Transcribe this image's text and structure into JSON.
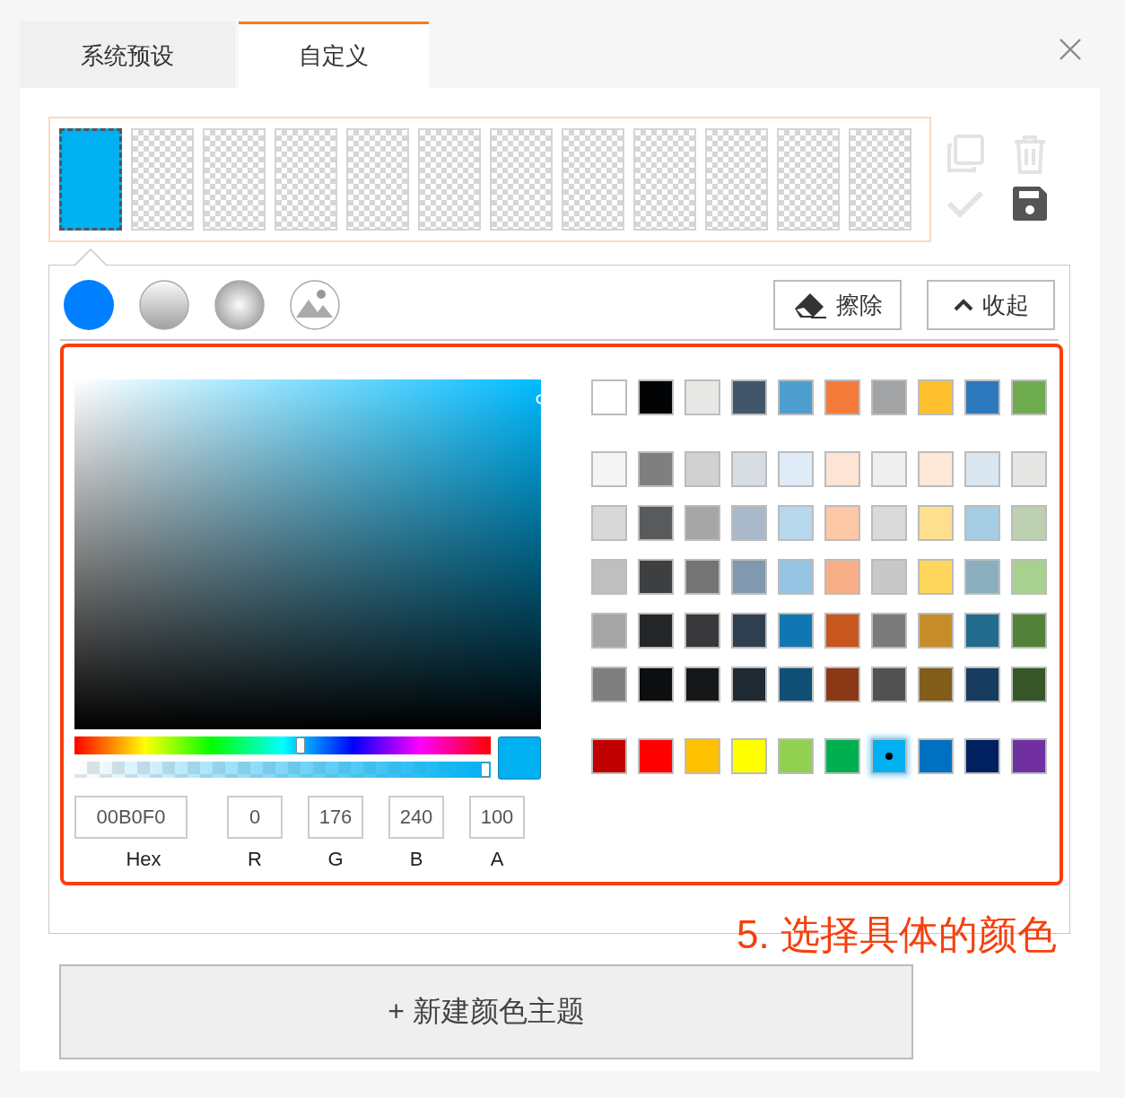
{
  "tabs": [
    {
      "label": "系统预设",
      "selected": false
    },
    {
      "label": "自定义",
      "selected": true
    }
  ],
  "theme_slots": [
    {
      "color": "#00b0f0",
      "selected": true
    },
    {
      "selected": false
    },
    {
      "selected": false
    },
    {
      "selected": false
    },
    {
      "selected": false
    },
    {
      "selected": false
    },
    {
      "selected": false
    },
    {
      "selected": false
    },
    {
      "selected": false
    },
    {
      "selected": false
    },
    {
      "selected": false
    },
    {
      "selected": false
    }
  ],
  "actions": [
    {
      "kind": "copy",
      "disabled": true
    },
    {
      "kind": "delete",
      "disabled": true
    },
    {
      "kind": "confirm",
      "disabled": true
    },
    {
      "kind": "save",
      "disabled": false
    }
  ],
  "buttons": [
    {
      "kind": "erase",
      "label": "擦除"
    },
    {
      "kind": "collapse",
      "label": "收起"
    }
  ],
  "picker": {
    "hue": {
      "level": 0.544
    },
    "alpha": {
      "level": 1
    },
    "fields": [
      {
        "value": "00B0F0",
        "label": "Hex"
      },
      {
        "value": "0",
        "label": "R"
      },
      {
        "value": "176",
        "label": "G"
      },
      {
        "value": "240",
        "label": "B"
      },
      {
        "value": "100",
        "label": "A"
      }
    ]
  },
  "swatch_groups": [
    [
      [
        {
          "color": "#ffffff",
          "selected": false
        },
        {
          "color": "#020305",
          "selected": false
        },
        {
          "color": "#e7e8e6",
          "selected": false
        },
        {
          "color": "#41566a",
          "selected": false
        },
        {
          "color": "#4e9fcf",
          "selected": false
        },
        {
          "color": "#f47b3a",
          "selected": false
        },
        {
          "color": "#a2a3a5",
          "selected": false
        },
        {
          "color": "#fdbf2d",
          "selected": false
        },
        {
          "color": "#2e78bd",
          "selected": false
        },
        {
          "color": "#6fac4f",
          "selected": false
        }
      ]
    ],
    [
      [
        {
          "color": "#f5f5f5",
          "selected": false
        },
        {
          "color": "#7f7f7f",
          "selected": false
        },
        {
          "color": "#d1d1d1",
          "selected": false
        },
        {
          "color": "#d7dde2",
          "selected": false
        },
        {
          "color": "#dfebf7",
          "selected": false
        },
        {
          "color": "#fde5d5",
          "selected": false
        },
        {
          "color": "#efefef",
          "selected": false
        },
        {
          "color": "#fee8d7",
          "selected": false
        },
        {
          "color": "#dae6f0",
          "selected": false
        },
        {
          "color": "#e6e7e5",
          "selected": false
        }
      ],
      [
        {
          "color": "#d8d8d8",
          "selected": false
        },
        {
          "color": "#595a5c",
          "selected": false
        },
        {
          "color": "#a6a6a6",
          "selected": false
        },
        {
          "color": "#a9b9c9",
          "selected": false
        },
        {
          "color": "#b7d8ec",
          "selected": false
        },
        {
          "color": "#fcc8a5",
          "selected": false
        },
        {
          "color": "#dadada",
          "selected": false
        },
        {
          "color": "#fedf8e",
          "selected": false
        },
        {
          "color": "#a5cde3",
          "selected": false
        },
        {
          "color": "#bdd0b2",
          "selected": false
        }
      ],
      [
        {
          "color": "#bfbfbf",
          "selected": false
        },
        {
          "color": "#3e3f41",
          "selected": false
        },
        {
          "color": "#747474",
          "selected": false
        },
        {
          "color": "#8199b0",
          "selected": false
        },
        {
          "color": "#96c4e3",
          "selected": false
        },
        {
          "color": "#f8af88",
          "selected": false
        },
        {
          "color": "#c8c8c8",
          "selected": false
        },
        {
          "color": "#fed65c",
          "selected": false
        },
        {
          "color": "#8aaebe",
          "selected": false
        },
        {
          "color": "#a8d08f",
          "selected": false
        }
      ],
      [
        {
          "color": "#a5a5a5",
          "selected": false
        },
        {
          "color": "#252628",
          "selected": false
        },
        {
          "color": "#38383a",
          "selected": false
        },
        {
          "color": "#2e4050",
          "selected": false
        },
        {
          "color": "#1077b3",
          "selected": false
        },
        {
          "color": "#c8561f",
          "selected": false
        },
        {
          "color": "#7b7b7b",
          "selected": false
        },
        {
          "color": "#c68d2a",
          "selected": false
        },
        {
          "color": "#226a8e",
          "selected": false
        },
        {
          "color": "#528139",
          "selected": false
        }
      ],
      [
        {
          "color": "#7f7f7f",
          "selected": false
        },
        {
          "color": "#0c0e10",
          "selected": false
        },
        {
          "color": "#161718",
          "selected": false
        },
        {
          "color": "#1f2a33",
          "selected": false
        },
        {
          "color": "#0f4f75",
          "selected": false
        },
        {
          "color": "#8b3816",
          "selected": false
        },
        {
          "color": "#525252",
          "selected": false
        },
        {
          "color": "#815d1a",
          "selected": false
        },
        {
          "color": "#173c5e",
          "selected": false
        },
        {
          "color": "#365628",
          "selected": false
        }
      ]
    ],
    [
      [
        {
          "color": "#c00000",
          "selected": false
        },
        {
          "color": "#ff0000",
          "selected": false
        },
        {
          "color": "#ffc000",
          "selected": false
        },
        {
          "color": "#ffff00",
          "selected": false
        },
        {
          "color": "#92d050",
          "selected": false
        },
        {
          "color": "#00b050",
          "selected": false
        },
        {
          "color": "#00b0f0",
          "selected": true
        },
        {
          "color": "#0070c0",
          "selected": false
        },
        {
          "color": "#002060",
          "selected": false
        },
        {
          "color": "#7030a0",
          "selected": false
        }
      ]
    ]
  ],
  "annotation": "5. 选择具体的颜色",
  "new_theme_button": "+ 新建颜色主题"
}
